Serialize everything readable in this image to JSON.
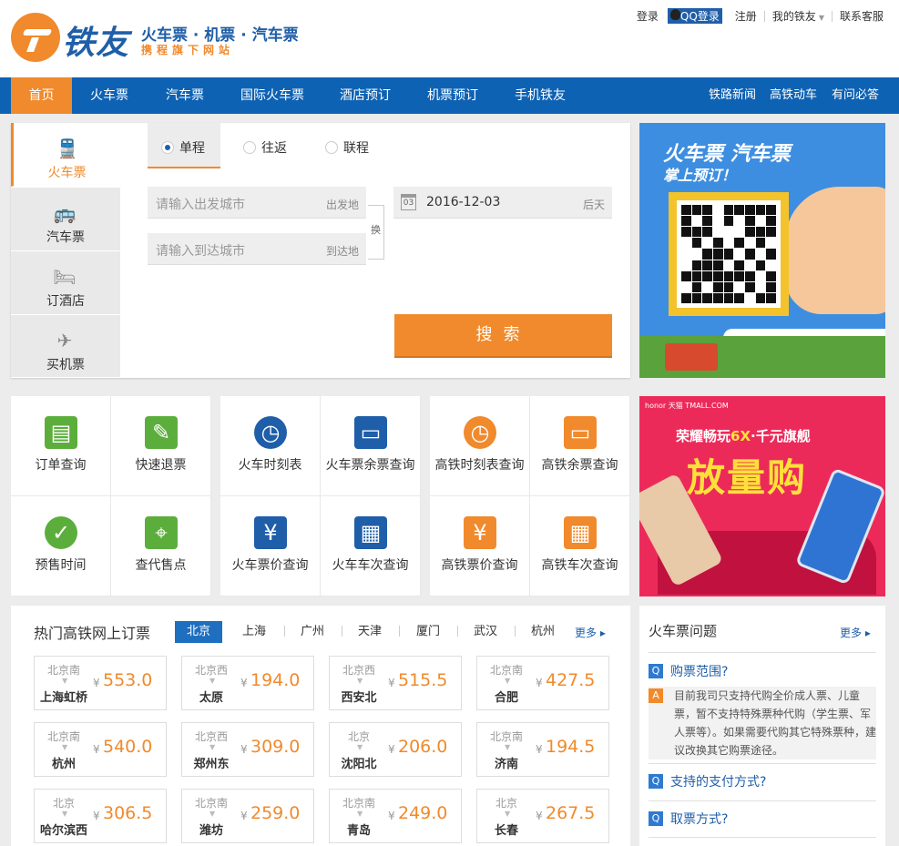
{
  "header": {
    "logo_name": "铁友",
    "slogan": "火车票 · 机票 · 汽车票",
    "sub_slogan": "携程旗下网站",
    "top_links": {
      "login": "登录",
      "qq_login": "QQ登录",
      "register": "注册",
      "my_account": "我的铁友",
      "customer_service": "联系客服"
    }
  },
  "nav": {
    "items": [
      "首页",
      "火车票",
      "汽车票",
      "国际火车票",
      "酒店预订",
      "机票预订",
      "手机铁友"
    ],
    "right_items": [
      "铁路新闻",
      "高铁动车",
      "有问必答"
    ],
    "active_color": "#f08a2c",
    "bar_color": "#0e62b3"
  },
  "booking": {
    "side_tabs": [
      {
        "label": "火车票",
        "icon": "train-icon"
      },
      {
        "label": "汽车票",
        "icon": "bus-icon"
      },
      {
        "label": "订酒店",
        "icon": "bed-icon"
      },
      {
        "label": "买机票",
        "icon": "plane-icon"
      }
    ],
    "trip_types": [
      "单程",
      "往返",
      "联程"
    ],
    "from_placeholder": "请输入出发城市",
    "from_tag": "出发地",
    "to_placeholder": "请输入到达城市",
    "to_tag": "到达地",
    "swap_label": "换",
    "calendar_day": "03",
    "date": "2016-12-03",
    "date_tag": "后天",
    "search_label": "搜索"
  },
  "ad1": {
    "line1": "火车票 汽车票",
    "line2": "掌上预订！"
  },
  "services": [
    {
      "label": "订单查询",
      "icon": "document-icon",
      "color": "#5cae3c",
      "shape": "sq"
    },
    {
      "label": "快速退票",
      "icon": "edit-icon",
      "color": "#5cae3c",
      "shape": "sq"
    },
    {
      "label": "火车时刻表",
      "icon": "clock-train-icon",
      "color": "#1f5ea8",
      "shape": "ci"
    },
    {
      "label": "火车票余票查询",
      "icon": "ticket-icon",
      "color": "#1f5ea8",
      "shape": "sq"
    },
    {
      "label": "高铁时刻表查询",
      "icon": "clock-train-icon",
      "color": "#f08a2c",
      "shape": "ci"
    },
    {
      "label": "高铁余票查询",
      "icon": "ticket-icon",
      "color": "#f08a2c",
      "shape": "sq"
    },
    {
      "label": "预售时间",
      "icon": "check-icon",
      "color": "#5cae3c",
      "shape": "ci"
    },
    {
      "label": "查代售点",
      "icon": "location-icon",
      "color": "#5cae3c",
      "shape": "sq"
    },
    {
      "label": "火车票价查询",
      "icon": "price-icon",
      "color": "#1f5ea8",
      "shape": "sq"
    },
    {
      "label": "火车车次查询",
      "icon": "calendar-icon",
      "color": "#1f5ea8",
      "shape": "sq"
    },
    {
      "label": "高铁票价查询",
      "icon": "price-icon",
      "color": "#f08a2c",
      "shape": "sq"
    },
    {
      "label": "高铁车次查询",
      "icon": "calendar-icon",
      "color": "#f08a2c",
      "shape": "sq"
    }
  ],
  "ad2": {
    "brand": "honor 天猫 TMALL.COM",
    "slogan_a": "荣耀畅玩",
    "slogan_b": "6X",
    "slogan_c": "·千元旗舰",
    "big": "放量购"
  },
  "hot": {
    "title": "热门高铁网上订票",
    "cities": [
      "北京",
      "上海",
      "广州",
      "天津",
      "厦门",
      "武汉",
      "杭州"
    ],
    "more": "更多",
    "currency": "¥",
    "tickets": [
      {
        "from": "北京南",
        "to": "上海虹桥",
        "price": "553.0"
      },
      {
        "from": "北京西",
        "to": "太原",
        "price": "194.0"
      },
      {
        "from": "北京西",
        "to": "西安北",
        "price": "515.5"
      },
      {
        "from": "北京南",
        "to": "合肥",
        "price": "427.5"
      },
      {
        "from": "北京南",
        "to": "杭州",
        "price": "540.0"
      },
      {
        "from": "北京西",
        "to": "郑州东",
        "price": "309.0"
      },
      {
        "from": "北京",
        "to": "沈阳北",
        "price": "206.0"
      },
      {
        "from": "北京南",
        "to": "济南",
        "price": "194.5"
      },
      {
        "from": "北京",
        "to": "哈尔滨西",
        "price": "306.5"
      },
      {
        "from": "北京南",
        "to": "潍坊",
        "price": "259.0"
      },
      {
        "from": "北京南",
        "to": "青岛",
        "price": "249.0"
      },
      {
        "from": "北京",
        "to": "长春",
        "price": "267.5"
      }
    ]
  },
  "faq": {
    "title": "火车票问题",
    "more": "更多",
    "q_mark": "Q",
    "a_mark": "A",
    "q1": "购票范围?",
    "a1": "目前我司只支持代购全价成人票、儿童票，暂不支持特殊票种代购（学生票、军人票等）。如果需要代购其它特殊票种，建议改换其它购票途径。",
    "q2": "支持的支付方式?",
    "q3": "取票方式?"
  }
}
